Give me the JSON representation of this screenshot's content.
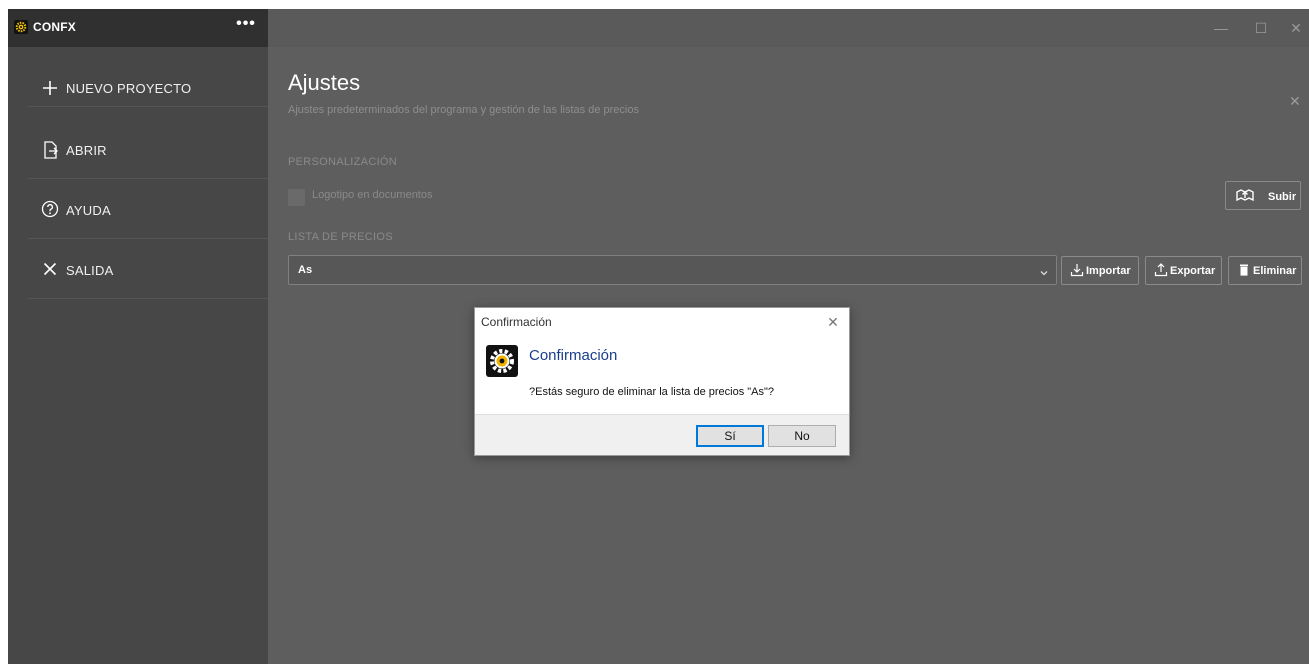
{
  "app": {
    "name": "CONFX",
    "more_icon": "ellipsis-icon",
    "logo_icon": "gear-logo-icon"
  },
  "sidebar": {
    "items": [
      {
        "label": "NUEVO PROYECTO",
        "icon": "plus-icon"
      },
      {
        "label": "ABRIR",
        "icon": "open-file-icon"
      },
      {
        "label": "AYUDA",
        "icon": "help-icon"
      },
      {
        "label": "SALIDA",
        "icon": "close-icon"
      }
    ]
  },
  "window_controls": {
    "minimize": "—",
    "maximize": "☐",
    "close": "✕"
  },
  "main": {
    "title": "Ajustes",
    "subtitle": "Ajustes predeterminados del programa y gestión de las listas de precios",
    "close": "✕",
    "personalization": {
      "label": "PERSONALIZACIÓN",
      "logo_checkbox_label": "Logotipo en documentos",
      "logo_checked": false,
      "upload_label": "Subir"
    },
    "price_list": {
      "label": "LISTA DE PRECIOS",
      "selected": "As",
      "import_label": "Importar",
      "export_label": "Exportar",
      "delete_label": "Eliminar"
    }
  },
  "dialog": {
    "title": "Confirmación",
    "heading": "Confirmación",
    "message": "?Estás seguro de eliminar la lista de precios \"As\"?",
    "yes_label": "Sí",
    "no_label": "No",
    "close": "✕"
  },
  "colors": {
    "sidebar_bg": "#474747",
    "main_bg": "#5e5e5e",
    "header_bg": "#303030",
    "dialog_heading": "#1a3e8c",
    "focus_border": "#0078d7"
  }
}
